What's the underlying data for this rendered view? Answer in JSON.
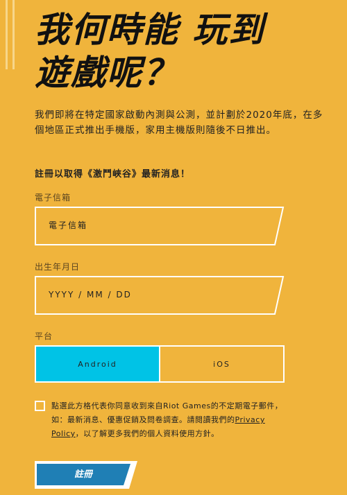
{
  "page": {
    "heading_line1": "我何時能 玩到",
    "heading_line2": "遊戲呢？",
    "intro": "我們即將在特定國家啟動內測與公測，並計劃於2020年底，在多個地區正式推出手機版，家用主機版則隨後不日推出。",
    "signup_prompt": "註冊以取得《激鬥峽谷》最新消息！"
  },
  "form": {
    "email": {
      "label": "電子信箱",
      "placeholder": "電子信箱",
      "value": ""
    },
    "birthdate": {
      "label": "出生年月日",
      "placeholder": "YYYY / MM / DD",
      "value": ""
    },
    "platform": {
      "label": "平台",
      "options": [
        "Android",
        "iOS"
      ],
      "selected": "Android"
    },
    "consent": {
      "checked": false,
      "text_before": "點選此方格代表你同意收到來自Riot Games的不定期電子郵件，如：最新消息、優惠促銷及問卷調查。請閱讀我們的",
      "link": "Privacy Policy",
      "text_after": "，以了解更多我們的個人資料使用方針。"
    },
    "submit_label": "註冊"
  },
  "colors": {
    "background": "#F0B43C",
    "selected": "#00C3E6",
    "submit": "#1F7FB5",
    "outline": "#FFFFFF"
  }
}
